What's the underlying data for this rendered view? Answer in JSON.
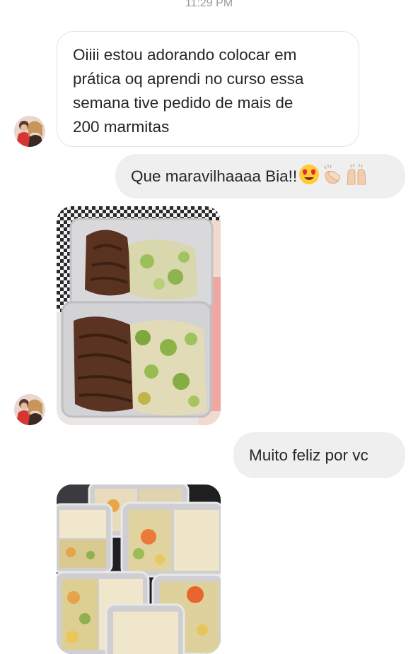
{
  "header": {
    "timestamp": "11:29 PM"
  },
  "messages": [
    {
      "sender": "other",
      "text": "Oiiii estou adorando colocar em prática oq aprendi no curso essa semana tive pedido de mais de 200 marmitas",
      "lines": [
        "Oiiii estou adorando colocar em",
        "prática oq aprendi no curso essa",
        "semana tive pedido de mais de",
        "200 marmitas"
      ]
    },
    {
      "sender": "me",
      "text": "Que maravilhaaaa Bia!!",
      "emojis": [
        "heart-eyes-emoji",
        "clapping-hands-emoji",
        "raised-hands-emoji"
      ]
    },
    {
      "sender": "other",
      "type": "photo",
      "alt": "marmitas-com-carne-desfiada-e-arroz-com-brocolis"
    },
    {
      "sender": "me",
      "text": "Muito feliz por vc"
    },
    {
      "sender": "other",
      "type": "photo",
      "alt": "marmitas-com-arroz-e-legumes"
    }
  ],
  "colors": {
    "incoming_bubble_border": "#e3e3e3",
    "outgoing_bubble_bg": "#efefef",
    "text": "#262626",
    "timestamp": "#9a9a9a"
  }
}
